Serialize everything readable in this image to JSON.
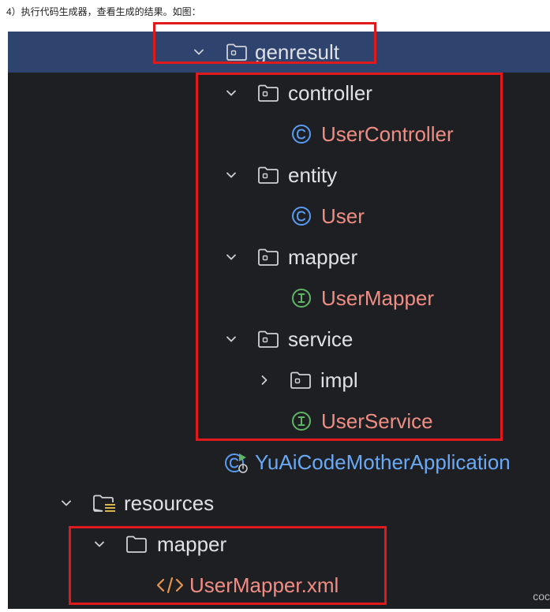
{
  "caption": "4）执行代码生成器，查看生成的结果。如图：",
  "tree": {
    "genresult": "genresult",
    "controller": "controller",
    "user_controller": "UserController",
    "entity": "entity",
    "user": "User",
    "mapper": "mapper",
    "user_mapper": "UserMapper",
    "service": "service",
    "impl": "impl",
    "user_service": "UserService",
    "app": "YuAiCodeMotherApplication",
    "resources": "resources",
    "res_mapper": "mapper",
    "user_mapper_xml": "UserMapper.xml"
  },
  "icons": {
    "folder": "folder-icon",
    "class": "class-icon",
    "interface": "interface-icon",
    "spring_app": "spring-run-icon",
    "resources": "resources-folder-icon",
    "xml": "xml-file-icon",
    "chevron_down": "chevron-down-icon",
    "chevron_right": "chevron-right-icon"
  },
  "colors": {
    "background": "#1e1f22",
    "selection": "#2e436e",
    "class_file_text": "#f08d84",
    "app_text": "#6aa9f5",
    "class_icon": "#5a9bf2",
    "interface_icon": "#5fb565",
    "highlight_box": "#e0191d"
  },
  "watermark": "coc"
}
